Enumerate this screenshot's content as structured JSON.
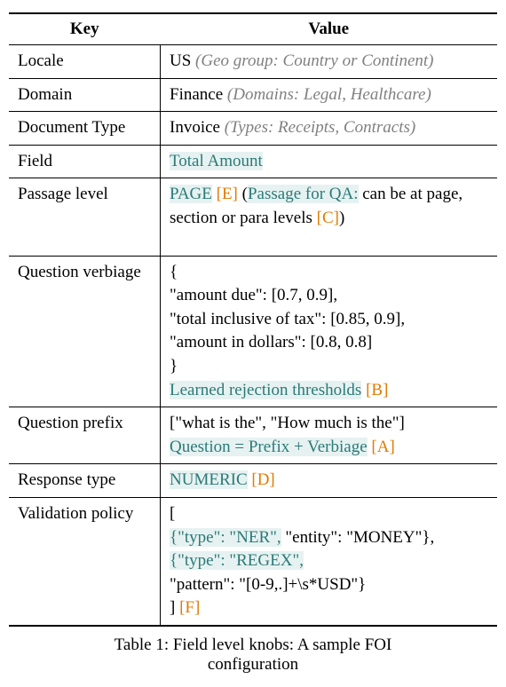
{
  "header": {
    "key": "Key",
    "value": "Value"
  },
  "rows": {
    "locale": {
      "key": "Locale",
      "main": "US",
      "note": " (Geo group: Country or Continent)"
    },
    "domain": {
      "key": "Domain",
      "main": "Finance",
      "note": " (Domains: Legal, Healthcare)"
    },
    "doctype": {
      "key": "Document Type",
      "main": "Invoice",
      "note": " (Types: Receipts, Contracts)"
    },
    "field": {
      "key": "Field",
      "val": "Total Amount"
    },
    "passage": {
      "key": "Passage level",
      "page": "PAGE",
      "tagE": " [E]",
      "open": " (",
      "qa": "Passage for QA:",
      "desc": " can be at page, section or para levels ",
      "tagC": "[C]",
      "close": ")"
    },
    "verbiage": {
      "key": "Question verbiage",
      "l1": "{",
      "l2": "\"amount due\": [0.7, 0.9],",
      "l3": "\"total inclusive of tax\": [0.85, 0.9],",
      "l4": "\"amount in dollars\": [0.8, 0.8]",
      "l5": "}",
      "learned": "Learned rejection thresholds",
      "tagB": " [B]"
    },
    "prefix": {
      "key": "Question prefix",
      "l1": "[\"what is the\", \"How much is the\"]",
      "eq": "Question = Prefix + Verbiage",
      "tagA": " [A]"
    },
    "response": {
      "key": "Response type",
      "val": "NUMERIC",
      "tagD": " [D]"
    },
    "validation": {
      "key": "Validation policy",
      "l1": "[",
      "ner_a": "{\"type\": \"NER\",",
      "ner_b": " \"entity\": \"MONEY\"},",
      "regex": "{\"type\": \"REGEX\",",
      "pattern": "\"pattern\": \"[0-9,.]+\\s*USD\"}",
      "close": "]",
      "tagF": " [F]"
    }
  },
  "caption": {
    "l1": "Table 1: Field level knobs: A sample FOI",
    "l2": "configuration"
  },
  "chart_data": {
    "type": "table",
    "title": "Table 1: Field level knobs: A sample FOI configuration",
    "columns": [
      "Key",
      "Value"
    ],
    "rows": [
      [
        "Locale",
        "US (Geo group: Country or Continent)"
      ],
      [
        "Domain",
        "Finance (Domains: Legal, Healthcare)"
      ],
      [
        "Document Type",
        "Invoice (Types: Receipts, Contracts)"
      ],
      [
        "Field",
        "Total Amount"
      ],
      [
        "Passage level",
        "PAGE [E] (Passage for QA: can be at page, section or para levels [C])"
      ],
      [
        "Question verbiage",
        "{ \"amount due\": [0.7, 0.9], \"total inclusive of tax\": [0.85, 0.9], \"amount in dollars\": [0.8, 0.8] } Learned rejection thresholds [B]"
      ],
      [
        "Question prefix",
        "[\"what is the\", \"How much is the\"] Question = Prefix + Verbiage [A]"
      ],
      [
        "Response type",
        "NUMERIC [D]"
      ],
      [
        "Validation policy",
        "[ {\"type\": \"NER\", \"entity\": \"MONEY\"}, {\"type\": \"REGEX\", \"pattern\": \"[0-9,.]+\\s*USD\"} ] [F]"
      ]
    ]
  }
}
